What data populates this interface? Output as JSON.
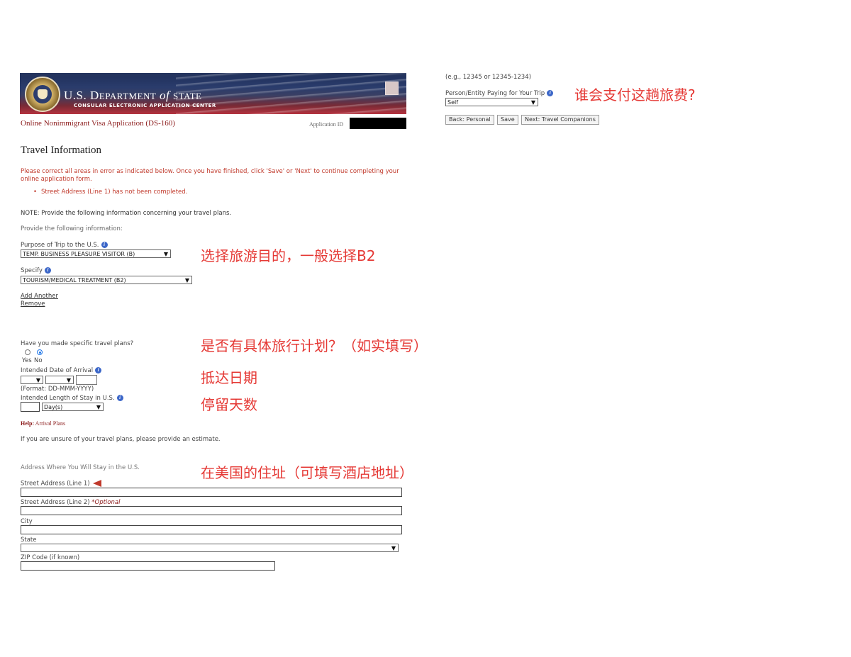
{
  "header": {
    "dept_title_prefix": "U.S. D",
    "dept_title_main": "EPARTMENT",
    "dept_of": "of",
    "dept_state": "STATE",
    "center": "CONSULAR ELECTRONIC APPLICATION CENTER",
    "form_title": "Online Nonimmigrant Visa Application (DS-160)",
    "application_id_label": "Application ID"
  },
  "page": {
    "title": "Travel Information",
    "error_message": "Please correct all areas in error as indicated below. Once you have finished, click 'Save' or 'Next' to continue completing your online application form.",
    "errors": [
      "Street Address (Line 1) has not been completed."
    ],
    "note": "NOTE: Provide the following information concerning your travel plans.",
    "provide": "Provide the following information:"
  },
  "purpose": {
    "label": "Purpose of Trip to the U.S.",
    "value": "TEMP. BUSINESS PLEASURE VISITOR (B)",
    "specify_label": "Specify",
    "specify_value": "TOURISM/MEDICAL TREATMENT (B2)",
    "add_another": "Add Another",
    "remove": "Remove"
  },
  "plans": {
    "label": "Have you made specific travel plans?",
    "yes": "Yes",
    "no": "No",
    "selected": "No"
  },
  "arrival": {
    "label": "Intended Date of Arrival",
    "format": "(Format: DD-MMM-YYYY)"
  },
  "stay": {
    "label": "Intended Length of Stay in U.S.",
    "unit": "Day(s)"
  },
  "help": {
    "prefix": "Help:",
    "title": "Arrival Plans",
    "text": "If you are unsure of your travel plans, please provide an estimate."
  },
  "address": {
    "section": "Address Where You Will Stay in the U.S.",
    "street1": "Street Address (Line 1)",
    "street2": "Street Address (Line 2)",
    "optional": "*Optional",
    "city": "City",
    "state": "State",
    "zip": "ZIP Code (if known)"
  },
  "right": {
    "zip_hint": "(e.g., 12345 or 12345-1234)",
    "payer_label": "Person/Entity Paying for Your Trip",
    "payer_value": "Self",
    "back_button": "Back: Personal",
    "save_button": "Save",
    "next_button": "Next: Travel Companions"
  },
  "annotations": {
    "payer": "谁会支付这趟旅费?",
    "purpose": "选择旅游目的，一般选择B2",
    "plans": "是否有具体旅行计划？（如实填写）",
    "arrival": "抵达日期",
    "stay": "停留天数",
    "address": "在美国的住址（可填写酒店地址）"
  },
  "colors": {
    "error_red": "#c0392b",
    "annotation_red": "#e53935",
    "header_title_red": "#8b1a1a",
    "banner_blue": "#24345e"
  }
}
